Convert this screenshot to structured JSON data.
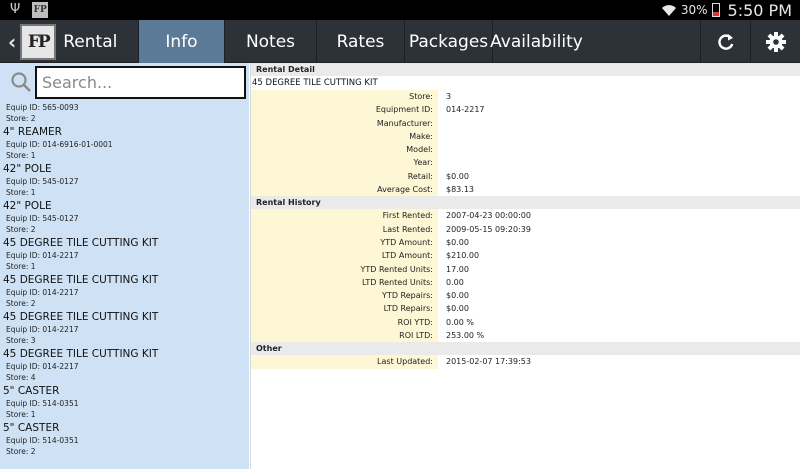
{
  "status_bar": {
    "battery_percent": "30%",
    "time": "5:50 PM",
    "icons": [
      "usb-icon",
      "app-notification-icon",
      "wifi-icon",
      "battery-icon"
    ]
  },
  "action_bar": {
    "title": "Rental",
    "logo_text": "FP",
    "tabs": [
      {
        "label": "Info",
        "active": true
      },
      {
        "label": "Notes",
        "active": false
      },
      {
        "label": "Rates",
        "active": false
      },
      {
        "label": "Packages",
        "active": false
      },
      {
        "label": "Availability",
        "active": false
      }
    ],
    "actions": [
      "refresh-icon",
      "settings-icon"
    ]
  },
  "search": {
    "placeholder": "Search...",
    "value": ""
  },
  "rental_list": {
    "first_partial": {
      "equip": "Equip ID: 565-0093",
      "store": "Store: 2"
    },
    "items": [
      {
        "name": "4\" REAMER",
        "equip": "Equip ID: 014-6916-01-0001",
        "store": "Store: 1"
      },
      {
        "name": "42\" POLE",
        "equip": "Equip ID: 545-0127",
        "store": "Store: 1"
      },
      {
        "name": "42\" POLE",
        "equip": "Equip ID: 545-0127",
        "store": "Store: 2"
      },
      {
        "name": "45 DEGREE TILE CUTTING KIT",
        "equip": "Equip ID: 014-2217",
        "store": "Store: 1"
      },
      {
        "name": "45 DEGREE TILE CUTTING KIT",
        "equip": "Equip ID: 014-2217",
        "store": "Store: 2"
      },
      {
        "name": "45 DEGREE TILE CUTTING KIT",
        "equip": "Equip ID: 014-2217",
        "store": "Store: 3"
      },
      {
        "name": "45 DEGREE TILE CUTTING KIT",
        "equip": "Equip ID: 014-2217",
        "store": "Store: 4"
      },
      {
        "name": "5\" CASTER",
        "equip": "Equip ID: 514-0351",
        "store": "Store: 1"
      },
      {
        "name": "5\" CASTER",
        "equip": "Equip ID: 514-0351",
        "store": "Store: 2"
      }
    ]
  },
  "detail": {
    "rental_detail_header": "Rental Detail",
    "title": "45 DEGREE TILE CUTTING KIT",
    "rental_detail": [
      {
        "label": "Store:",
        "value": "3"
      },
      {
        "label": "Equipment ID:",
        "value": "014-2217"
      },
      {
        "label": "Manufacturer:",
        "value": ""
      },
      {
        "label": "Make:",
        "value": ""
      },
      {
        "label": "Model:",
        "value": ""
      },
      {
        "label": "Year:",
        "value": ""
      },
      {
        "label": "Retail:",
        "value": "$0.00"
      },
      {
        "label": "Average Cost:",
        "value": "$83.13"
      }
    ],
    "rental_history_header": "Rental History",
    "rental_history": [
      {
        "label": "First Rented:",
        "value": "2007-04-23 00:00:00"
      },
      {
        "label": "Last Rented:",
        "value": "2009-05-15 09:20:39"
      },
      {
        "label": "YTD Amount:",
        "value": "$0.00"
      },
      {
        "label": "LTD Amount:",
        "value": "$210.00"
      },
      {
        "label": "YTD Rented Units:",
        "value": "17.00"
      },
      {
        "label": "LTD Rented Units:",
        "value": "0.00"
      },
      {
        "label": "YTD Repairs:",
        "value": "$0.00"
      },
      {
        "label": "LTD Repairs:",
        "value": "$0.00"
      },
      {
        "label": "ROI YTD:",
        "value": "0.00 %"
      },
      {
        "label": "ROI LTD:",
        "value": "253.00 %"
      }
    ],
    "other_header": "Other",
    "other": [
      {
        "label": "Last Updated:",
        "value": "2015-02-07 17:39:53"
      }
    ]
  }
}
